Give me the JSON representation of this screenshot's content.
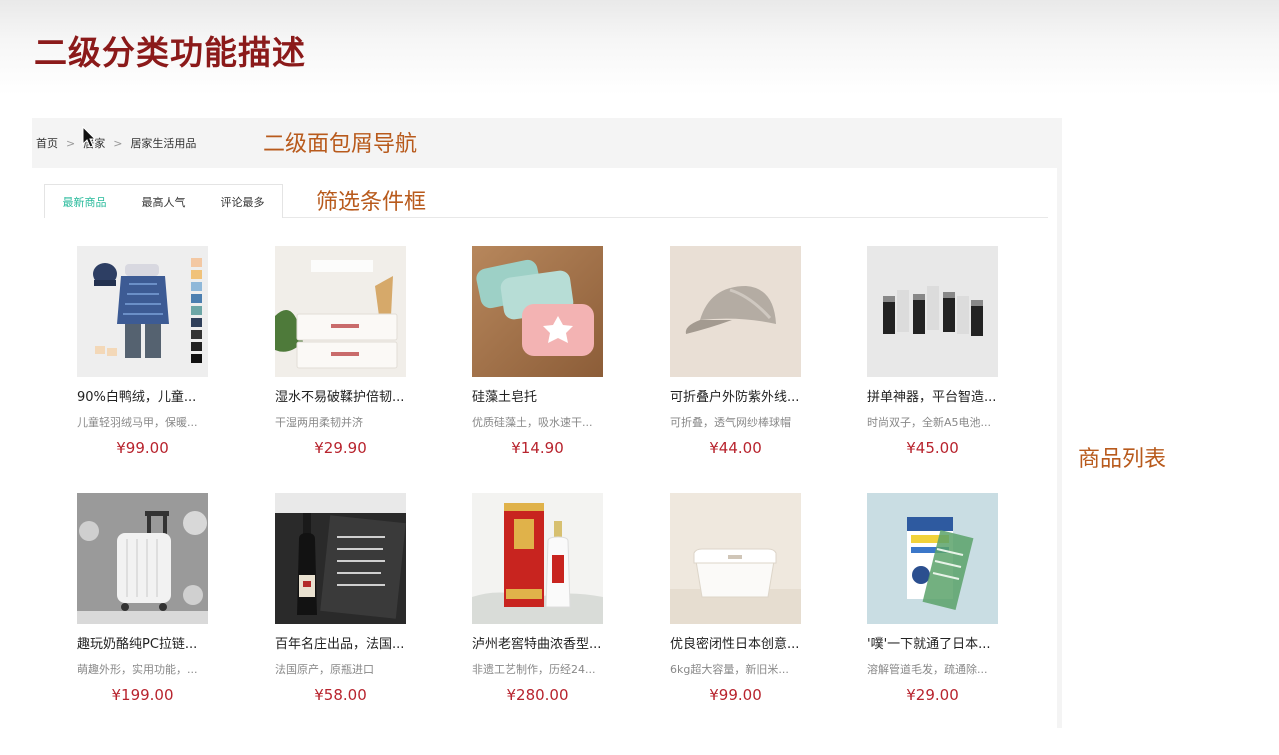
{
  "slide": {
    "title": "二级分类功能描述",
    "notes": {
      "breadcrumb": "二级面包屑导航",
      "filter": "筛选条件框",
      "list": "商品列表"
    }
  },
  "breadcrumb": {
    "items": [
      "首页",
      "居家",
      "居家生活用品"
    ],
    "separator": ">"
  },
  "filter_tabs": [
    {
      "label": "最新商品",
      "active": true
    },
    {
      "label": "最高人气",
      "active": false
    },
    {
      "label": "评论最多",
      "active": false
    }
  ],
  "products": [
    {
      "name": "90%白鸭绒，儿童...",
      "desc": "儿童轻羽绒马甲，保暖...",
      "price": "¥99.00",
      "image": "kids-down-vest"
    },
    {
      "name": "湿水不易破鞣护倍韧...",
      "desc": "干湿两用柔韧并济",
      "price": "¥29.90",
      "image": "tissue-pack"
    },
    {
      "name": "硅藻土皂托",
      "desc": "优质硅藻土，吸水速干...",
      "price": "¥14.90",
      "image": "soap-dish"
    },
    {
      "name": "可折叠户外防紫外线...",
      "desc": "可折叠，透气网纱棒球帽",
      "price": "¥44.00",
      "image": "cap"
    },
    {
      "name": "拼单神器，平台智造...",
      "desc": "时尚双子，全新A5电池...",
      "price": "¥45.00",
      "image": "batteries"
    },
    {
      "name": "趣玩奶酪纯PC拉链...",
      "desc": "萌趣外形，实用功能，...",
      "price": "¥199.00",
      "image": "suitcase"
    },
    {
      "name": "百年名庄出品，法国...",
      "desc": "法国原产，原瓶进口",
      "price": "¥58.00",
      "image": "wine"
    },
    {
      "name": "泸州老窖特曲浓香型...",
      "desc": "非遗工艺制作，历经24...",
      "price": "¥280.00",
      "image": "liquor"
    },
    {
      "name": "优良密闭性日本创意...",
      "desc": "6kg超大容量，新旧米...",
      "price": "¥99.00",
      "image": "rice-box"
    },
    {
      "name": "'噗'一下就通了日本...",
      "desc": "溶解管道毛发，疏通除...",
      "price": "¥29.00",
      "image": "drain-cleaner"
    }
  ],
  "colors": {
    "title": "#8b1a1a",
    "note": "#b85a1c",
    "active_tab": "#27ba9b",
    "price": "#b8242e"
  }
}
